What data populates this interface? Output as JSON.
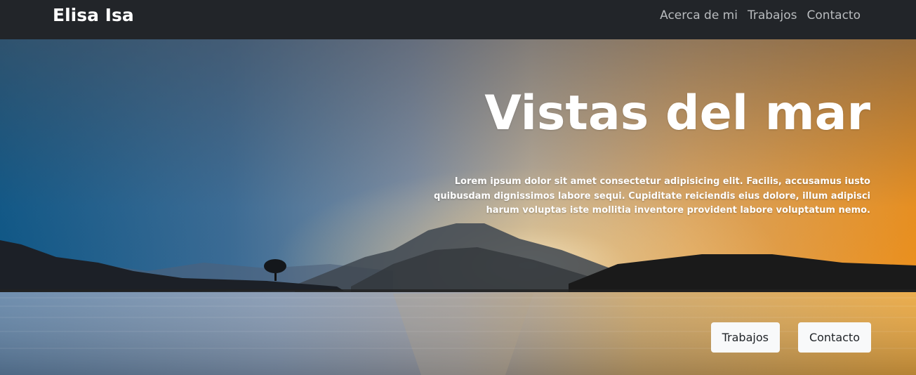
{
  "navbar": {
    "brand": "Elisa Isa",
    "links": [
      "Acerca de mi",
      "Trabajos",
      "Contacto"
    ]
  },
  "hero": {
    "title": "Vistas del mar",
    "text": "Lorem ipsum dolor sit amet consectetur adipisicing elit. Facilis, accusamus iusto quibusdam dignissimos labore sequi. Cupiditate reiciendis eius dolore, illum adipisci harum voluptas iste mollitia inventore provident labore voluptatum nemo.",
    "buttons": [
      "Trabajos",
      "Contacto"
    ]
  },
  "colors": {
    "navbar_bg": "#222529",
    "nav_link": "#b9bcbf",
    "button_bg": "#f8f9fa",
    "sky_left": "#1f5f91",
    "sky_right": "#f5a623"
  }
}
